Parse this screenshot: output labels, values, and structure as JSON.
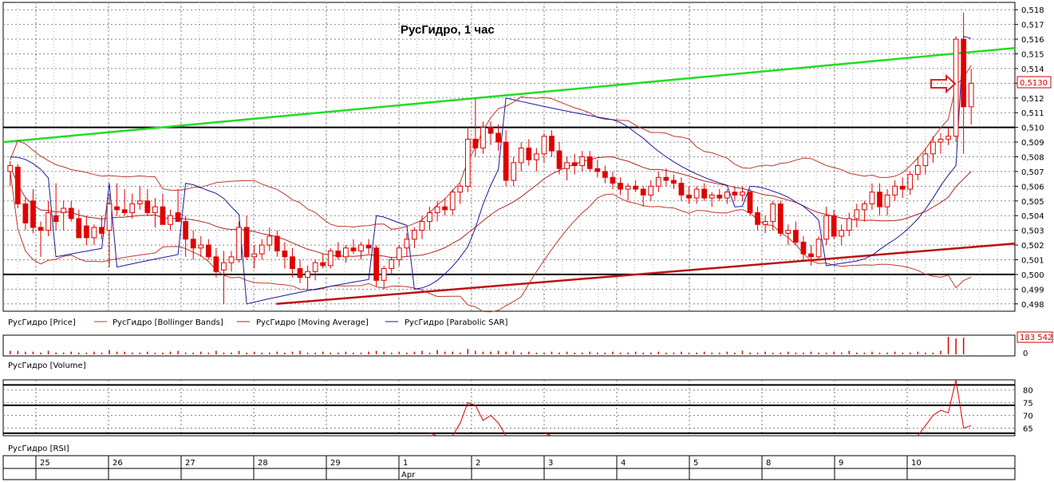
{
  "title": "РусГидро,  1 час",
  "colors": {
    "candle": "#e00000",
    "bollinger": "#c0392b",
    "moving_average": "#b22222",
    "sar": "#1a1aa0",
    "green_trend": "#22dd22",
    "red_trend": "#bb1111",
    "grid": "#888888",
    "panel_border": "#000000"
  },
  "price_panel": {
    "legend": [
      {
        "label": "РусГидро [Price]",
        "color": "#000000"
      },
      {
        "label": "РусГидро [Bollinger Bands]",
        "color": "#c0392b"
      },
      {
        "label": "РусГидро [Moving Average]",
        "color": "#b22222"
      },
      {
        "label": "РусГидро [Parabolic SAR]",
        "color": "#1a1aa0"
      }
    ],
    "current_price_label": "0,5130"
  },
  "volume_panel": {
    "legend": "РусГидро [Volume]",
    "last_label": "183 542",
    "zero_label": "0"
  },
  "rsi_panel": {
    "legend": "РусГидро [RSI]"
  },
  "x_axis": {
    "day_labels": [
      "25",
      "26",
      "27",
      "28",
      "29",
      "1",
      "2",
      "3",
      "4",
      "5",
      "8",
      "9",
      "10"
    ],
    "month_label": "Apr"
  },
  "chart_data": [
    {
      "type": "candlestick",
      "title": "РусГидро,  1 час",
      "ylim": [
        0.4975,
        0.5185
      ],
      "y_ticks": [
        "0,518",
        "0,517",
        "0,516",
        "0,515",
        "0,514",
        "0,513",
        "0,512",
        "0,511",
        "0,510",
        "0,509",
        "0,508",
        "0,507",
        "0,506",
        "0,505",
        "0,504",
        "0,503",
        "0,502",
        "0,501",
        "0,500",
        "0,499",
        "0,498"
      ],
      "horizontal_levels": [
        0.51,
        0.5
      ],
      "trendlines": [
        {
          "name": "green",
          "from": [
            0,
            0.509
          ],
          "to": [
            1.0,
            0.5154
          ]
        },
        {
          "name": "red",
          "from": [
            0.27,
            0.498
          ],
          "to": [
            1.0,
            0.5021
          ]
        }
      ],
      "ohlc": [
        [
          0.507,
          0.5077,
          0.506,
          0.5074
        ],
        [
          0.5073,
          0.5075,
          0.5045,
          0.5048
        ],
        [
          0.5048,
          0.5052,
          0.503,
          0.5035
        ],
        [
          0.505,
          0.5058,
          0.5028,
          0.5032
        ],
        [
          0.5032,
          0.5036,
          0.5012,
          0.503
        ],
        [
          0.503,
          0.505,
          0.5026,
          0.5042
        ],
        [
          0.504,
          0.5062,
          0.503,
          0.5036
        ],
        [
          0.5042,
          0.505,
          0.503,
          0.5045
        ],
        [
          0.5045,
          0.505,
          0.5036,
          0.5038
        ],
        [
          0.5038,
          0.5044,
          0.5028,
          0.5025
        ],
        [
          0.5033,
          0.504,
          0.502,
          0.5025
        ],
        [
          0.5025,
          0.5034,
          0.502,
          0.5032
        ],
        [
          0.5032,
          0.504,
          0.5024,
          0.5028
        ],
        [
          0.503,
          0.5055,
          0.5005,
          0.5048
        ],
        [
          0.5046,
          0.5062,
          0.504,
          0.5044
        ],
        [
          0.5044,
          0.5058,
          0.504,
          0.5042
        ],
        [
          0.5042,
          0.5055,
          0.5038,
          0.5048
        ],
        [
          0.5048,
          0.506,
          0.5044,
          0.505
        ],
        [
          0.505,
          0.5058,
          0.504,
          0.5042
        ],
        [
          0.5042,
          0.5052,
          0.5032,
          0.5046
        ],
        [
          0.5046,
          0.5055,
          0.5038,
          0.5034
        ],
        [
          0.5034,
          0.5044,
          0.503,
          0.504
        ],
        [
          0.5042,
          0.5058,
          0.5036,
          0.5036
        ],
        [
          0.5036,
          0.504,
          0.5012,
          0.5024
        ],
        [
          0.5024,
          0.503,
          0.501,
          0.5018
        ],
        [
          0.5018,
          0.5026,
          0.5012,
          0.502
        ],
        [
          0.502,
          0.5024,
          0.501,
          0.5012
        ],
        [
          0.5012,
          0.5018,
          0.4998,
          0.5002
        ],
        [
          0.5003,
          0.5016,
          0.498,
          0.5008
        ],
        [
          0.5008,
          0.5016,
          0.5002,
          0.5012
        ],
        [
          0.501,
          0.5036,
          0.5008,
          0.5032
        ],
        [
          0.5032,
          0.504,
          0.501,
          0.5012
        ],
        [
          0.5012,
          0.502,
          0.5004,
          0.5014
        ],
        [
          0.5014,
          0.5024,
          0.501,
          0.502
        ],
        [
          0.502,
          0.5032,
          0.5016,
          0.5026
        ],
        [
          0.5026,
          0.503,
          0.5012,
          0.5016
        ],
        [
          0.5016,
          0.5022,
          0.5004,
          0.5012
        ],
        [
          0.5012,
          0.5018,
          0.4998,
          0.5004
        ],
        [
          0.5004,
          0.501,
          0.4994,
          0.4998
        ],
        [
          0.4998,
          0.5006,
          0.499,
          0.5002
        ],
        [
          0.5002,
          0.501,
          0.4996,
          0.5008
        ],
        [
          0.5008,
          0.5014,
          0.5004,
          0.5006
        ],
        [
          0.5006,
          0.5018,
          0.5004,
          0.5016
        ],
        [
          0.5016,
          0.5022,
          0.501,
          0.5012
        ],
        [
          0.5012,
          0.502,
          0.5008,
          0.5018
        ],
        [
          0.5018,
          0.5024,
          0.5014,
          0.5016
        ],
        [
          0.5016,
          0.5022,
          0.501,
          0.502
        ],
        [
          0.502,
          0.5024,
          0.5014,
          0.5018
        ],
        [
          0.5018,
          0.502,
          0.4992,
          0.4996
        ],
        [
          0.4996,
          0.5006,
          0.499,
          0.5004
        ],
        [
          0.5004,
          0.5012,
          0.5,
          0.501
        ],
        [
          0.501,
          0.502,
          0.5006,
          0.5018
        ],
        [
          0.5018,
          0.5028,
          0.5012,
          0.5024
        ],
        [
          0.5024,
          0.5032,
          0.5018,
          0.503
        ],
        [
          0.503,
          0.504,
          0.5024,
          0.5036
        ],
        [
          0.5036,
          0.5046,
          0.503,
          0.5042
        ],
        [
          0.5042,
          0.505,
          0.5036,
          0.5046
        ],
        [
          0.5046,
          0.5052,
          0.504,
          0.5044
        ],
        [
          0.5044,
          0.5058,
          0.504,
          0.5056
        ],
        [
          0.5056,
          0.5062,
          0.5048,
          0.506
        ],
        [
          0.506,
          0.51,
          0.5056,
          0.5092
        ],
        [
          0.5092,
          0.512,
          0.508,
          0.5086
        ],
        [
          0.5086,
          0.5104,
          0.5082,
          0.51
        ],
        [
          0.51,
          0.5104,
          0.5088,
          0.5096
        ],
        [
          0.5096,
          0.5102,
          0.5084,
          0.509
        ],
        [
          0.509,
          0.5098,
          0.506,
          0.5064
        ],
        [
          0.5064,
          0.508,
          0.506,
          0.5076
        ],
        [
          0.5076,
          0.509,
          0.507,
          0.5086
        ],
        [
          0.5086,
          0.5092,
          0.5074,
          0.5078
        ],
        [
          0.5078,
          0.5086,
          0.507,
          0.5082
        ],
        [
          0.5082,
          0.5096,
          0.5076,
          0.5094
        ],
        [
          0.5094,
          0.5098,
          0.508,
          0.5084
        ],
        [
          0.5084,
          0.509,
          0.5068,
          0.5072
        ],
        [
          0.5072,
          0.508,
          0.5064,
          0.5076
        ],
        [
          0.5076,
          0.5082,
          0.5068,
          0.5074
        ],
        [
          0.5074,
          0.5084,
          0.507,
          0.508
        ],
        [
          0.508,
          0.5084,
          0.507,
          0.5072
        ],
        [
          0.5072,
          0.5078,
          0.5066,
          0.507
        ],
        [
          0.507,
          0.5074,
          0.5062,
          0.5066
        ],
        [
          0.5066,
          0.507,
          0.5058,
          0.5062
        ],
        [
          0.5062,
          0.5066,
          0.5054,
          0.5058
        ],
        [
          0.5058,
          0.5062,
          0.505,
          0.506
        ],
        [
          0.506,
          0.5064,
          0.5056,
          0.5058
        ],
        [
          0.5058,
          0.506,
          0.5046,
          0.5054
        ],
        [
          0.5054,
          0.5064,
          0.505,
          0.506
        ],
        [
          0.506,
          0.507,
          0.5056,
          0.5066
        ],
        [
          0.5066,
          0.5072,
          0.506,
          0.5064
        ],
        [
          0.5064,
          0.5068,
          0.5058,
          0.5062
        ],
        [
          0.5062,
          0.5066,
          0.505,
          0.5054
        ],
        [
          0.5054,
          0.506,
          0.5048,
          0.5052
        ],
        [
          0.5052,
          0.506,
          0.5048,
          0.5058
        ],
        [
          0.5058,
          0.5062,
          0.505,
          0.5052
        ],
        [
          0.5052,
          0.5056,
          0.5046,
          0.5054
        ],
        [
          0.5054,
          0.5058,
          0.505,
          0.5052
        ],
        [
          0.5052,
          0.5058,
          0.5048,
          0.5056
        ],
        [
          0.5056,
          0.506,
          0.505,
          0.5054
        ],
        [
          0.5054,
          0.506,
          0.505,
          0.5056
        ],
        [
          0.5056,
          0.5058,
          0.504,
          0.5042
        ],
        [
          0.5042,
          0.5046,
          0.503,
          0.5034
        ],
        [
          0.5034,
          0.504,
          0.5028,
          0.5036
        ],
        [
          0.5036,
          0.505,
          0.503,
          0.5048
        ],
        [
          0.5048,
          0.505,
          0.5026,
          0.5028
        ],
        [
          0.5028,
          0.5034,
          0.502,
          0.503
        ],
        [
          0.503,
          0.5036,
          0.502,
          0.5022
        ],
        [
          0.5022,
          0.5026,
          0.501,
          0.5014
        ],
        [
          0.5014,
          0.502,
          0.5006,
          0.5012
        ],
        [
          0.5012,
          0.5026,
          0.501,
          0.5024
        ],
        [
          0.5024,
          0.5046,
          0.502,
          0.504
        ],
        [
          0.504,
          0.5044,
          0.5024,
          0.5026
        ],
        [
          0.5026,
          0.5034,
          0.502,
          0.503
        ],
        [
          0.503,
          0.5042,
          0.5026,
          0.5038
        ],
        [
          0.5038,
          0.5048,
          0.5032,
          0.5044
        ],
        [
          0.5044,
          0.505,
          0.5036,
          0.5048
        ],
        [
          0.5048,
          0.5062,
          0.5044,
          0.5056
        ],
        [
          0.5056,
          0.5062,
          0.504,
          0.5046
        ],
        [
          0.5046,
          0.5058,
          0.504,
          0.5054
        ],
        [
          0.5054,
          0.5064,
          0.505,
          0.506
        ],
        [
          0.506,
          0.5066,
          0.5052,
          0.5058
        ],
        [
          0.5058,
          0.507,
          0.5054,
          0.5068
        ],
        [
          0.5068,
          0.508,
          0.5064,
          0.5074
        ],
        [
          0.5074,
          0.5086,
          0.5068,
          0.5082
        ],
        [
          0.5082,
          0.5094,
          0.5076,
          0.509
        ],
        [
          0.509,
          0.5096,
          0.5082,
          0.5092
        ],
        [
          0.5092,
          0.51,
          0.5088,
          0.5094
        ],
        [
          0.5094,
          0.5162,
          0.509,
          0.516
        ],
        [
          0.516,
          0.5178,
          0.5082,
          0.5114
        ],
        [
          0.5114,
          0.514,
          0.5102,
          0.513
        ]
      ]
    },
    {
      "type": "bar",
      "title": "РусГидро [Volume]",
      "last_value": 183542,
      "values_relative": [
        0.2,
        0.2,
        0.15,
        0.15,
        0.1,
        0.2,
        0.1,
        0.1,
        0.15,
        0.1,
        0.1,
        0.15,
        0.1,
        0.25,
        0.15,
        0.15,
        0.1,
        0.1,
        0.15,
        0.1,
        0.1,
        0.15,
        0.2,
        0.1,
        0.1,
        0.15,
        0.1,
        0.2,
        0.1,
        0.1,
        0.2,
        0.1,
        0.15,
        0.1,
        0.1,
        0.15,
        0.1,
        0.15,
        0.2,
        0.1,
        0.1,
        0.15,
        0.1,
        0.1,
        0.15,
        0.1,
        0.1,
        0.15,
        0.2,
        0.15,
        0.1,
        0.15,
        0.1,
        0.15,
        0.2,
        0.1,
        0.25,
        0.15,
        0.15,
        0.1,
        0.3,
        0.2,
        0.15,
        0.15,
        0.2,
        0.15,
        0.2,
        0.1,
        0.15,
        0.1,
        0.1,
        0.15,
        0.1,
        0.15,
        0.1,
        0.1,
        0.15,
        0.1,
        0.1,
        0.15,
        0.1,
        0.1,
        0.15,
        0.1,
        0.1,
        0.15,
        0.1,
        0.1,
        0.15,
        0.1,
        0.1,
        0.15,
        0.1,
        0.1,
        0.15,
        0.1,
        0.2,
        0.1,
        0.1,
        0.15,
        0.1,
        0.1,
        0.15,
        0.1,
        0.1,
        0.15,
        0.1,
        0.1,
        0.15,
        0.1,
        0.2,
        0.1,
        0.1,
        0.15,
        0.1,
        0.1,
        0.15,
        0.1,
        0.1,
        0.15,
        0.1,
        0.1,
        0.2,
        1.0,
        0.9,
        0.95
      ]
    },
    {
      "type": "line",
      "title": "РусГидро [RSI]",
      "y_ticks": [
        "80",
        "75",
        "70",
        "65"
      ],
      "ylim": [
        62,
        84
      ],
      "levels": [
        82,
        74,
        63
      ],
      "visible_segments": [
        [
          [
            58,
            62
          ],
          [
            59,
            67
          ],
          [
            60,
            75
          ],
          [
            61,
            74
          ],
          [
            62,
            68
          ],
          [
            63,
            70
          ],
          [
            64,
            67
          ],
          [
            65,
            62
          ]
        ],
        [
          [
            70,
            63
          ],
          [
            71,
            62
          ]
        ],
        [
          [
            119,
            62
          ],
          [
            120,
            66
          ],
          [
            121,
            70
          ],
          [
            122,
            72
          ],
          [
            123,
            71
          ],
          [
            124,
            84
          ],
          [
            125,
            65
          ],
          [
            126,
            66
          ]
        ],
        [
          [
            55,
            63
          ],
          [
            56,
            62
          ]
        ]
      ]
    }
  ]
}
